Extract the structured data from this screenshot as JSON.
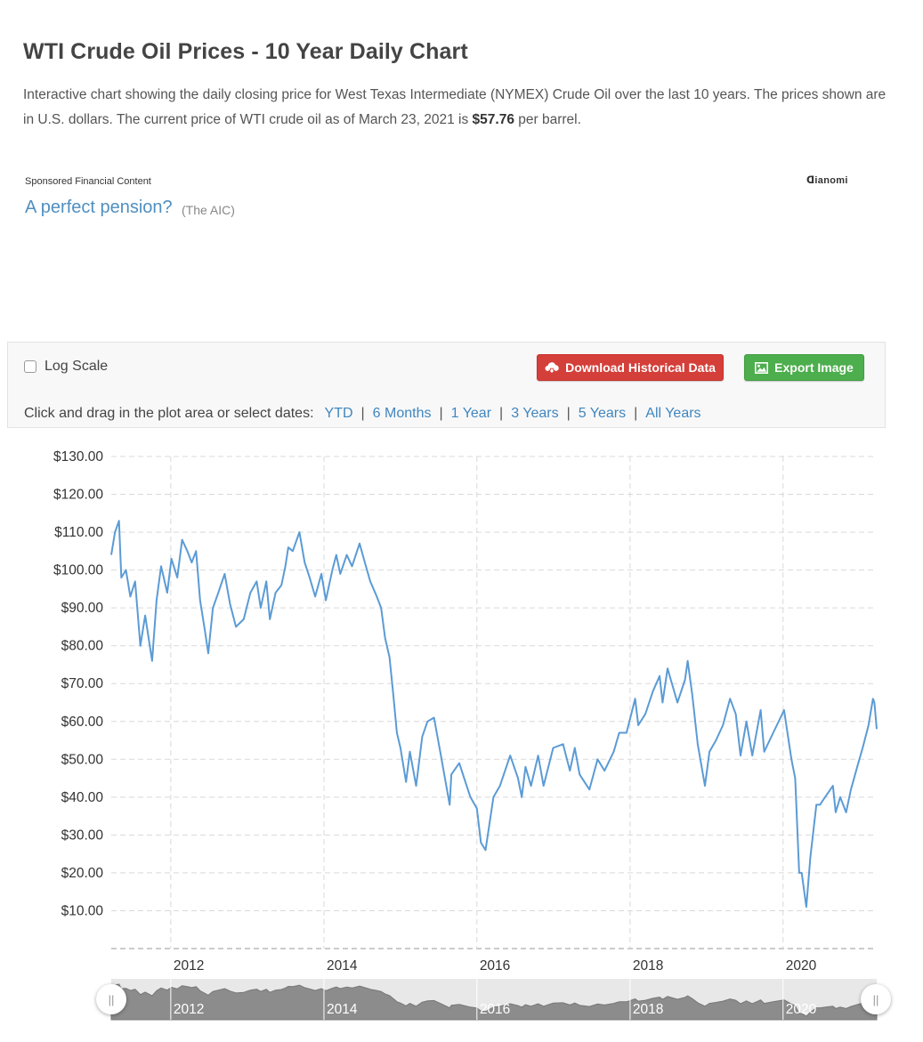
{
  "page": {
    "title": "WTI Crude Oil Prices - 10 Year Daily Chart",
    "intro_text": "Interactive chart showing the daily closing price for West Texas Intermediate (NYMEX) Crude Oil over the last 10 years. The prices shown are in U.S. dollars. The current price of WTI crude oil as of March 23, 2021 is ",
    "current_price": "$57.76",
    "intro_suffix": " per barrel."
  },
  "sponsored": {
    "label": "Sponsored Financial Content",
    "brand": "Dianomi",
    "link_text": "A perfect pension?",
    "source": "(The AIC)"
  },
  "toolbar": {
    "log_scale_label": "Log Scale",
    "download_label": "Download Historical Data",
    "export_label": "Export Image",
    "range_prompt": "Click and drag in the plot area or select dates:",
    "ranges": [
      "YTD",
      "6 Months",
      "1 Year",
      "3 Years",
      "5 Years",
      "All Years"
    ],
    "download_color": "#d43f3a",
    "export_color": "#4cae4c"
  },
  "chart_data": {
    "type": "line",
    "title": "",
    "xlabel": "",
    "ylabel": "",
    "y_ticks": [
      "$130.00",
      "$120.00",
      "$110.00",
      "$100.00",
      "$90.00",
      "$80.00",
      "$70.00",
      "$60.00",
      "$50.00",
      "$40.00",
      "$30.00",
      "$20.00",
      "$10.00"
    ],
    "x_ticks": [
      "2012",
      "2014",
      "2016",
      "2018",
      "2020"
    ],
    "ylim": [
      0,
      130
    ],
    "xlim": [
      "2011-03-23",
      "2021-03-23"
    ],
    "grid": true,
    "line_color": "#5b9bd5",
    "series": [
      {
        "name": "",
        "points": [
          [
            "2011-03-23",
            104
          ],
          [
            "2011-04-10",
            110
          ],
          [
            "2011-04-29",
            113
          ],
          [
            "2011-05-10",
            98
          ],
          [
            "2011-06-01",
            100
          ],
          [
            "2011-06-22",
            93
          ],
          [
            "2011-07-15",
            97
          ],
          [
            "2011-08-09",
            80
          ],
          [
            "2011-09-01",
            88
          ],
          [
            "2011-10-04",
            76
          ],
          [
            "2011-10-25",
            92
          ],
          [
            "2011-11-16",
            101
          ],
          [
            "2011-12-15",
            94
          ],
          [
            "2012-01-04",
            103
          ],
          [
            "2012-02-01",
            98
          ],
          [
            "2012-02-24",
            108
          ],
          [
            "2012-03-20",
            105
          ],
          [
            "2012-04-10",
            102
          ],
          [
            "2012-05-01",
            105
          ],
          [
            "2012-05-20",
            92
          ],
          [
            "2012-06-12",
            84
          ],
          [
            "2012-06-28",
            78
          ],
          [
            "2012-07-20",
            90
          ],
          [
            "2012-08-15",
            94
          ],
          [
            "2012-09-14",
            99
          ],
          [
            "2012-10-10",
            91
          ],
          [
            "2012-11-07",
            85
          ],
          [
            "2012-12-14",
            87
          ],
          [
            "2013-01-15",
            94
          ],
          [
            "2013-02-14",
            97
          ],
          [
            "2013-03-05",
            90
          ],
          [
            "2013-04-01",
            97
          ],
          [
            "2013-04-18",
            87
          ],
          [
            "2013-05-15",
            94
          ],
          [
            "2013-06-12",
            96
          ],
          [
            "2013-07-01",
            101
          ],
          [
            "2013-07-15",
            106
          ],
          [
            "2013-08-05",
            105
          ],
          [
            "2013-09-06",
            110
          ],
          [
            "2013-10-01",
            102
          ],
          [
            "2013-10-25",
            98
          ],
          [
            "2013-11-20",
            93
          ],
          [
            "2013-12-20",
            99
          ],
          [
            "2014-01-10",
            92
          ],
          [
            "2014-02-10",
            100
          ],
          [
            "2014-03-01",
            104
          ],
          [
            "2014-03-20",
            99
          ],
          [
            "2014-04-20",
            104
          ],
          [
            "2014-05-15",
            101
          ],
          [
            "2014-06-20",
            107
          ],
          [
            "2014-07-15",
            102
          ],
          [
            "2014-08-10",
            97
          ],
          [
            "2014-09-10",
            93
          ],
          [
            "2014-10-01",
            90
          ],
          [
            "2014-10-20",
            82
          ],
          [
            "2014-11-10",
            77
          ],
          [
            "2014-11-28",
            67
          ],
          [
            "2014-12-15",
            57
          ],
          [
            "2015-01-01",
            53
          ],
          [
            "2015-01-28",
            44
          ],
          [
            "2015-02-15",
            52
          ],
          [
            "2015-03-17",
            43
          ],
          [
            "2015-04-15",
            56
          ],
          [
            "2015-05-10",
            60
          ],
          [
            "2015-06-10",
            61
          ],
          [
            "2015-07-10",
            52
          ],
          [
            "2015-08-24",
            38
          ],
          [
            "2015-09-01",
            46
          ],
          [
            "2015-10-09",
            49
          ],
          [
            "2015-11-01",
            45
          ],
          [
            "2015-12-01",
            40
          ],
          [
            "2016-01-01",
            37
          ],
          [
            "2016-01-20",
            28
          ],
          [
            "2016-02-11",
            26
          ],
          [
            "2016-03-20",
            40
          ],
          [
            "2016-04-20",
            43
          ],
          [
            "2016-06-08",
            51
          ],
          [
            "2016-07-15",
            45
          ],
          [
            "2016-08-02",
            40
          ],
          [
            "2016-08-20",
            48
          ],
          [
            "2016-09-15",
            43
          ],
          [
            "2016-10-19",
            51
          ],
          [
            "2016-11-14",
            43
          ],
          [
            "2016-12-30",
            53
          ],
          [
            "2017-02-15",
            54
          ],
          [
            "2017-03-20",
            47
          ],
          [
            "2017-04-12",
            53
          ],
          [
            "2017-05-05",
            46
          ],
          [
            "2017-06-21",
            42
          ],
          [
            "2017-07-30",
            50
          ],
          [
            "2017-09-01",
            47
          ],
          [
            "2017-10-15",
            52
          ],
          [
            "2017-11-10",
            57
          ],
          [
            "2017-12-15",
            57
          ],
          [
            "2018-01-25",
            66
          ],
          [
            "2018-02-09",
            59
          ],
          [
            "2018-03-15",
            62
          ],
          [
            "2018-04-20",
            68
          ],
          [
            "2018-05-22",
            72
          ],
          [
            "2018-06-05",
            65
          ],
          [
            "2018-06-29",
            74
          ],
          [
            "2018-08-15",
            65
          ],
          [
            "2018-09-20",
            71
          ],
          [
            "2018-10-03",
            76
          ],
          [
            "2018-10-25",
            67
          ],
          [
            "2018-11-20",
            54
          ],
          [
            "2018-12-24",
            43
          ],
          [
            "2019-01-15",
            52
          ],
          [
            "2019-02-15",
            55
          ],
          [
            "2019-03-20",
            59
          ],
          [
            "2019-04-23",
            66
          ],
          [
            "2019-05-20",
            62
          ],
          [
            "2019-06-12",
            51
          ],
          [
            "2019-07-10",
            60
          ],
          [
            "2019-08-07",
            51
          ],
          [
            "2019-09-16",
            63
          ],
          [
            "2019-10-03",
            52
          ],
          [
            "2019-11-15",
            57
          ],
          [
            "2019-12-20",
            61
          ],
          [
            "2020-01-06",
            63
          ],
          [
            "2020-02-10",
            50
          ],
          [
            "2020-02-28",
            45
          ],
          [
            "2020-03-18",
            20
          ],
          [
            "2020-03-30",
            20
          ],
          [
            "2020-04-21",
            11
          ],
          [
            "2020-05-10",
            24
          ],
          [
            "2020-06-08",
            38
          ],
          [
            "2020-06-25",
            38
          ],
          [
            "2020-08-01",
            41
          ],
          [
            "2020-08-26",
            43
          ],
          [
            "2020-09-08",
            36
          ],
          [
            "2020-09-30",
            40
          ],
          [
            "2020-10-28",
            36
          ],
          [
            "2020-11-20",
            42
          ],
          [
            "2020-12-20",
            48
          ],
          [
            "2021-01-15",
            53
          ],
          [
            "2021-02-12",
            59
          ],
          [
            "2021-03-05",
            66
          ],
          [
            "2021-03-12",
            65
          ],
          [
            "2021-03-23",
            58
          ]
        ]
      }
    ]
  }
}
